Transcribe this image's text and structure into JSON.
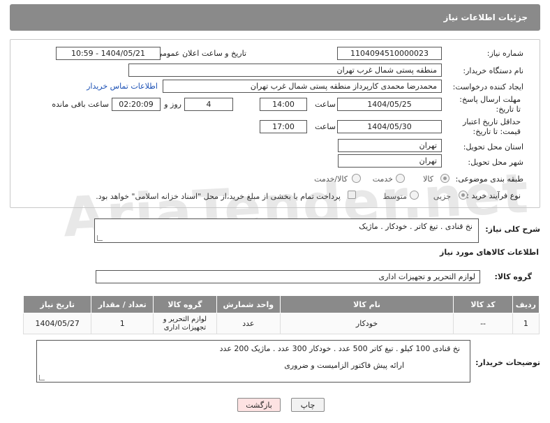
{
  "header": {
    "title": "جزئیات اطلاعات نیاز"
  },
  "form": {
    "need_number_label": "شماره نیاز:",
    "need_number": "1104094510000023",
    "announce_label": "تاریخ و ساعت اعلان عمومی:",
    "announce_value": "1404/05/21 - 10:59",
    "buyer_org_label": "نام دستگاه خریدار:",
    "buyer_org": "منطقه پستی شمال غرب تهران",
    "requester_label": "ایجاد کننده درخواست:",
    "requester": "محمدرضا  محمدی کارپرداز منطقه پستی شمال غرب تهران",
    "buyer_contact_link": "اطلاعات تماس خریدار",
    "deadline_label": "مهلت ارسال پاسخ: تا تاریخ:",
    "deadline_date": "1404/05/25",
    "time_label": "ساعت",
    "deadline_time": "14:00",
    "days_value": "4",
    "days_label": "روز و",
    "remaining_time": "02:20:09",
    "remaining_label": "ساعت باقی مانده",
    "price_validity_label": "حداقل تاریخ اعتبار قیمت: تا تاریخ:",
    "price_validity_date": "1404/05/30",
    "price_validity_time": "17:00",
    "province_label": "استان محل تحویل:",
    "province": "تهران",
    "city_label": "شهر محل تحویل:",
    "city": "تهران",
    "category_label": "طبقه بندی موضوعی:",
    "category_options": [
      "کالا",
      "خدمت",
      "کالا/خدمت"
    ],
    "process_label": "نوع فرآیند خرید :",
    "process_options": [
      "جزیی",
      "متوسط"
    ],
    "payment_note": "پرداخت تمام یا بخشی از مبلغ خرید،از محل \"اسناد خزانه اسلامی\" خواهد بود."
  },
  "description": {
    "label": "شرح کلی نیاز:",
    "value": "نخ قنادی . تیغ کاتر . خودکار . ماژیک"
  },
  "goods_info": {
    "title": "اطلاعات کالاهای مورد نیاز",
    "group_label": "گروه کالا:",
    "group_value": "لوازم التحریر و تجهیزات اداری"
  },
  "table": {
    "headers": [
      "ردیف",
      "کد کالا",
      "نام کالا",
      "واحد شمارش",
      "گروه کالا",
      "تعداد / مقدار",
      "تاریخ نیاز"
    ],
    "rows": [
      [
        "1",
        "--",
        "خودکار",
        "عدد",
        "لوازم التحریر و تجهیزات اداری",
        "1",
        "1404/05/27"
      ]
    ]
  },
  "buyer_notes": {
    "label": "توضیحات خریدار:",
    "line1": "نخ قنادی  100 کیلو  .  تیغ کاتر  500 عدد  .  خودکار  300 عدد  .  ماژیک  200 عدد",
    "line2": "ارائه پیش فاکتور الزامیست و ضروری"
  },
  "buttons": {
    "print": "چاپ",
    "back": "بازگشت"
  },
  "watermark": "AriaTender.net"
}
